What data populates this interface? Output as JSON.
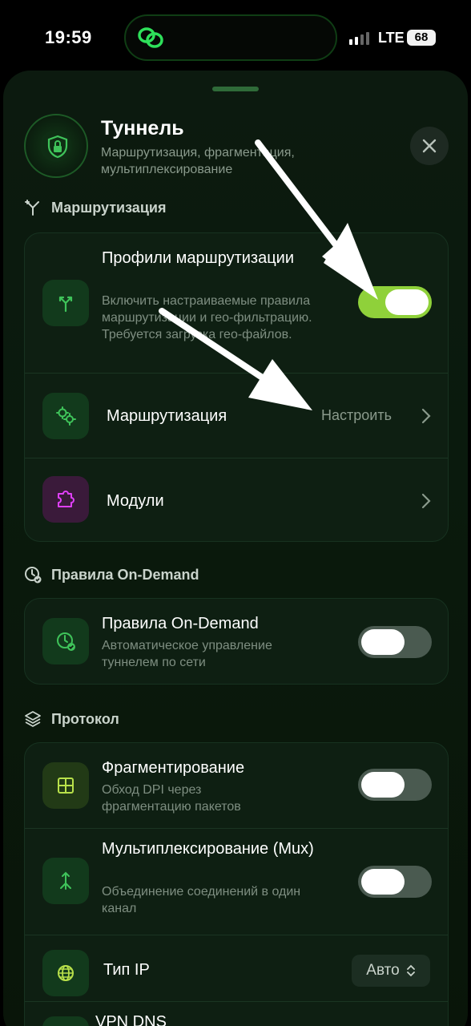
{
  "status_bar": {
    "time": "19:59",
    "network": "LTE",
    "battery": "68"
  },
  "header": {
    "title": "Туннель",
    "subtitle": "Маршрутизация, фрагментация, мультиплексирование"
  },
  "sections": {
    "routing": {
      "label": "Маршрутизация",
      "profiles": {
        "title": "Профили маршрутизации",
        "description": "Включить настраиваемые правила маршрутизации и гео-фильтрацию. Требуется загрузка гео-файлов.",
        "enabled": true
      },
      "routing_item": {
        "title": "Маршрутизация",
        "value": "Настроить"
      },
      "modules_item": {
        "title": "Модули"
      }
    },
    "on_demand": {
      "label": "Правила On-Demand",
      "rules": {
        "title": "Правила On-Demand",
        "description": "Автоматическое управление туннелем по сети",
        "enabled": false
      }
    },
    "protocol": {
      "label": "Протокол",
      "fragmentation": {
        "title": "Фрагментирование",
        "description": "Обход DPI через фрагментацию пакетов",
        "enabled": false
      },
      "mux": {
        "title": "Мультиплексирование (Mux)",
        "description": "Объединение соединений в один канал",
        "enabled": false
      },
      "ip_type": {
        "title": "Тип IP",
        "value": "Авто"
      },
      "vpn_dns": {
        "title": "VPN DNS"
      }
    }
  },
  "colors": {
    "accent_green": "#8fd13a",
    "sheet_bg": "#0c1a0f",
    "module_icon": "#e040fb"
  }
}
